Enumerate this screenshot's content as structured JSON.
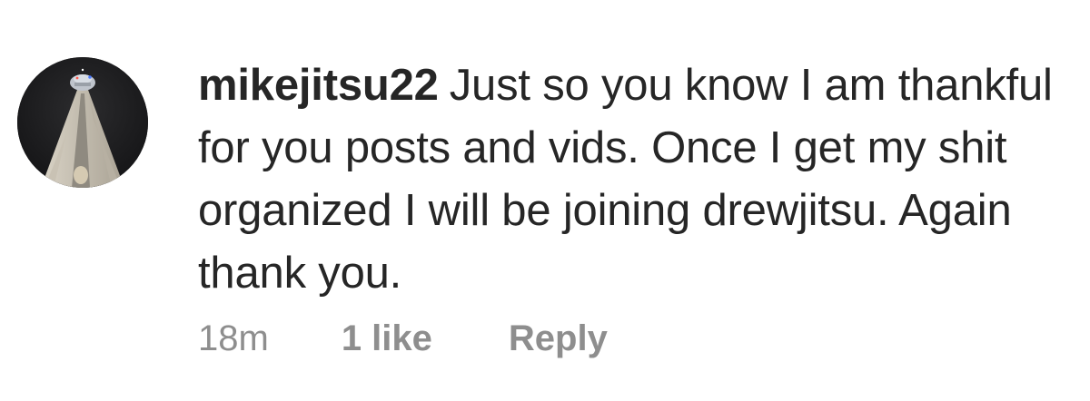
{
  "comment": {
    "avatar_icon": "profile-photo-tower-icon",
    "username": "mikejitsu22",
    "text": "Just so you know I am thankful for you posts and vids. Once I get my shit organized I will be joining drewjitsu. Again thank you.",
    "timestamp": "18m",
    "likes_label": "1 like",
    "reply_label": "Reply"
  },
  "colors": {
    "text": "#262626",
    "meta": "#8e8e8e",
    "background": "#ffffff"
  }
}
